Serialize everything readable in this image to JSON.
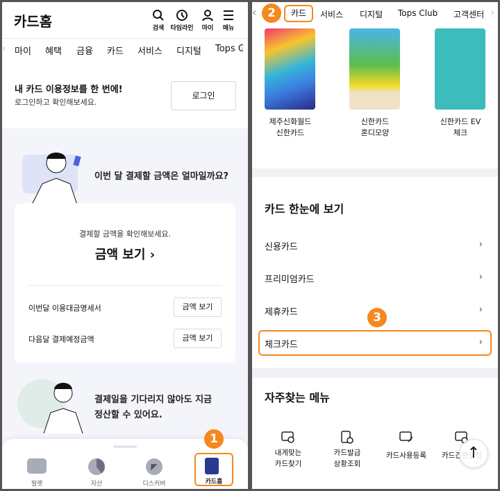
{
  "left": {
    "header": {
      "title": "카드홈",
      "icons": [
        {
          "name": "search-icon",
          "label": "검색"
        },
        {
          "name": "clock-icon",
          "label": "타임라인"
        },
        {
          "name": "person-icon",
          "label": "마이"
        },
        {
          "name": "menu-icon",
          "label": "메뉴"
        }
      ]
    },
    "tabs": [
      "마이",
      "혜택",
      "금융",
      "카드",
      "서비스",
      "디지털",
      "Tops Club"
    ],
    "login": {
      "title": "내 카드 이용정보를 한 번에!",
      "subtitle": "로그인하고 확인해보세요.",
      "button": "로그인"
    },
    "payment": {
      "question": "이번 달 결제할 금액은 얼마일까요?",
      "prompt": "결제할 금액을 확인해보세요.",
      "main_link": "금액 보기",
      "rows": [
        {
          "label": "이번달 이용대금명세서",
          "button": "금액 보기"
        },
        {
          "label": "다음달 결제예정금액",
          "button": "금액 보기"
        }
      ]
    },
    "settle": {
      "line1": "결제일을 기다리지 않아도 지금",
      "line2": "정산할 수 있어요."
    },
    "bottom_nav": [
      {
        "label": "월렛",
        "icon": "wallet-icon"
      },
      {
        "label": "자산",
        "icon": "pie-chart-icon"
      },
      {
        "label": "디스커버",
        "icon": "compass-icon"
      },
      {
        "label": "카드홈",
        "icon": "document-icon",
        "active": true
      }
    ],
    "badge": "1"
  },
  "right": {
    "tabs": [
      "카드",
      "서비스",
      "디지털",
      "Tops Club",
      "고객센터"
    ],
    "badge_tab": "2",
    "cards": [
      {
        "line1": "제주신화월드",
        "line2": "신한카드"
      },
      {
        "line1": "신한카드",
        "line2": "혼디모양"
      },
      {
        "line1": "신한카드 EV",
        "line2": "체크"
      }
    ],
    "overview": {
      "title": "카드 한눈에 보기",
      "items": [
        "신용카드",
        "프리미엄카드",
        "제휴카드",
        "체크카드"
      ]
    },
    "badge_row": "3",
    "frequent": {
      "title": "자주찾는 메뉴",
      "items": [
        {
          "line1": "내게맞는",
          "line2": "카드찾기"
        },
        {
          "line1": "카드발급",
          "line2": "상황조회"
        },
        {
          "line1": "카드사용등록",
          "line2": ""
        },
        {
          "line1": "카드간편설정",
          "line2": ""
        }
      ]
    }
  },
  "colors": {
    "accent": "#f5881f",
    "active_nav": "#2b3a8f",
    "bg_gray": "#f3f5fa"
  }
}
